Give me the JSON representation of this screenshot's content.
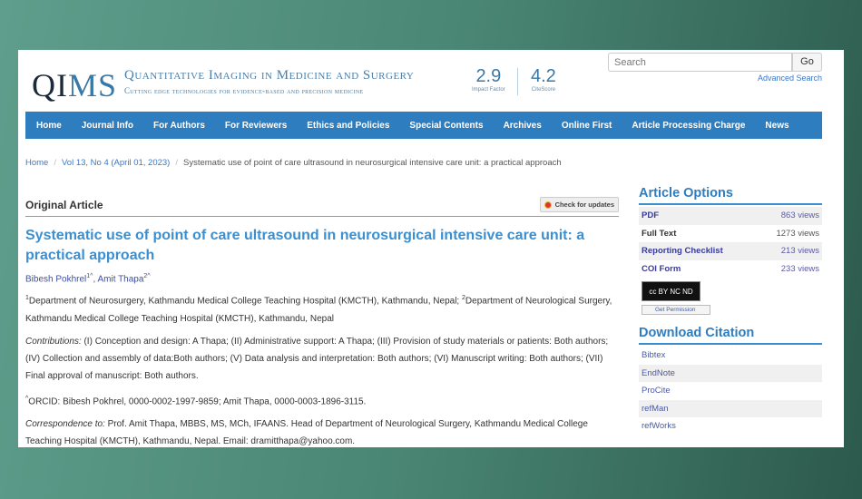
{
  "header": {
    "logo_a": "QI",
    "logo_b": "MS",
    "journal_title": "Quantitative Imaging in Medicine and Surgery",
    "tagline": "Cutting edge technologies for evidence-based and precision medicine",
    "impact_factor": "2.9",
    "impact_label": "Impact Factor",
    "citescore": "4.2",
    "citescore_label": "CiteScore",
    "search_placeholder": "Search",
    "go": "Go",
    "advanced": "Advanced Search"
  },
  "nav": [
    "Home",
    "Journal Info",
    "For Authors",
    "For Reviewers",
    "Ethics and Policies",
    "Special Contents",
    "Archives",
    "Online First",
    "Article Processing Charge",
    "News"
  ],
  "breadcrumb": {
    "home": "Home",
    "issue": "Vol 13, No 4 (April 01, 2023)",
    "current": "Systematic use of point of care ultrasound in neurosurgical intensive care unit: a practical approach"
  },
  "article": {
    "type": "Original Article",
    "check_updates": "Check for updates",
    "title": "Systematic use of point of care ultrasound in neurosurgical intensive care unit: a practical approach",
    "author1": "Bibesh Pokhrel",
    "author1_sup": "1^",
    "author2": "Amit Thapa",
    "author2_sup": "2^",
    "aff_sup1": "1",
    "aff1": "Department of Neurosurgery, Kathmandu Medical College Teaching Hospital (KMCTH), Kathmandu, Nepal; ",
    "aff_sup2": "2",
    "aff2": "Department of Neurological Surgery, Kathmandu Medical College Teaching Hospital (KMCTH), Kathmandu, Nepal",
    "contrib_label": "Contributions:",
    "contrib": " (I) Conception and design: A Thapa; (II) Administrative support: A Thapa; (III) Provision of study materials or patients: Both authors; (IV) Collection and assembly of data:Both authors; (V) Data analysis and interpretation: Both authors; (VI) Manuscript writing: Both authors; (VII) Final approval of manuscript: Both authors.",
    "orcid_sup": "^",
    "orcid": "ORCID: Bibesh Pokhrel, 0000-0002-1997-9859; Amit Thapa, 0000-0003-1896-3115.",
    "corr_label": "Correspondence to:",
    "corr": " Prof. Amit Thapa, MBBS, MS, MCh, IFAANS. Head of Department of Neurological Surgery, Kathmandu Medical College Teaching Hospital (KMCTH), Kathmandu, Nepal. Email: dramitthapa@yahoo.com."
  },
  "sidebar": {
    "options_title": "Article Options",
    "options": [
      {
        "name": "PDF",
        "views": "863 views"
      },
      {
        "name": "Full Text",
        "views": "1273 views"
      },
      {
        "name": "Reporting Checklist",
        "views": "213 views"
      },
      {
        "name": "COI Form",
        "views": "233 views"
      }
    ],
    "license": "cc BY NC ND",
    "permission": "Get Permission",
    "citation_title": "Download Citation",
    "citations": [
      "Bibtex",
      "EndNote",
      "ProCite",
      "refMan",
      "refWorks"
    ]
  }
}
